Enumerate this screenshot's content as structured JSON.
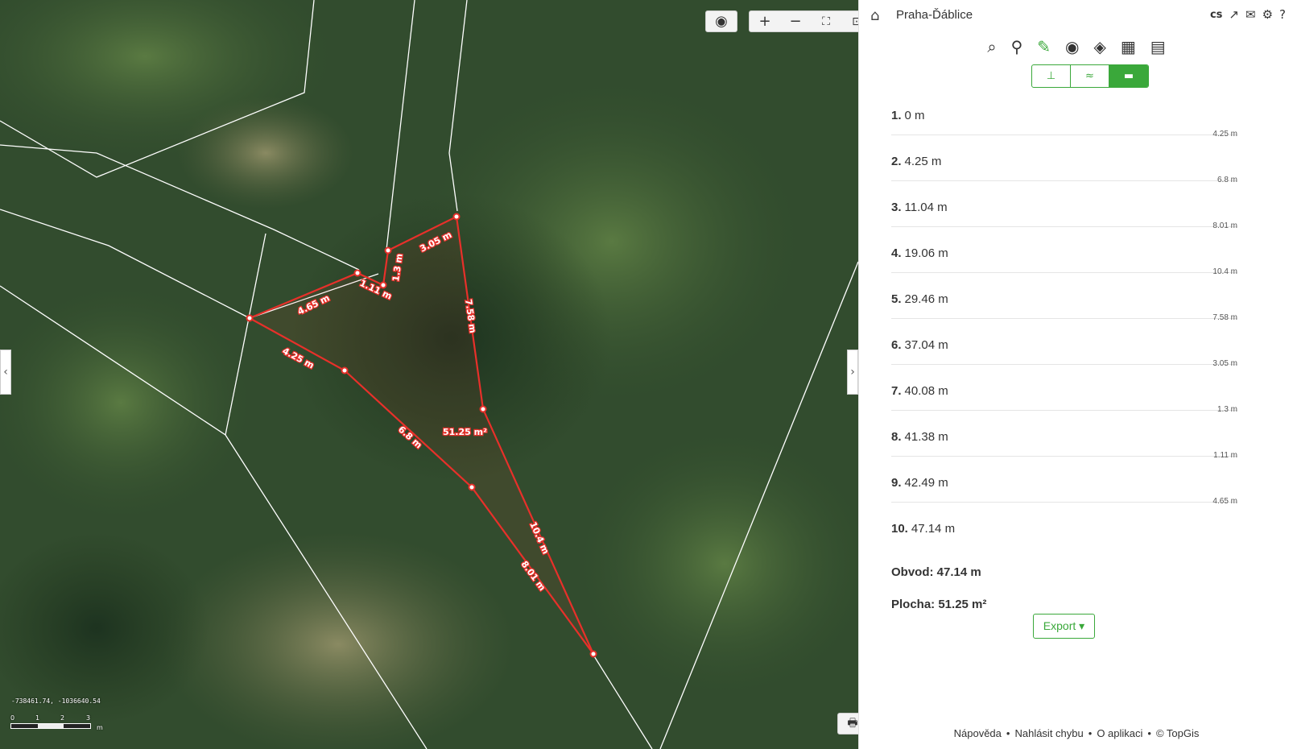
{
  "map": {
    "coordinates": "-738461.74, -1036640.54",
    "scale": {
      "labels": [
        "0",
        "1",
        "2",
        "3"
      ],
      "unit": "m"
    },
    "area_label": "51.25 m²",
    "segment_labels": [
      "4.25 m",
      "6.8 m",
      "8.01 m",
      "10.4 m",
      "7.58 m",
      "3.05 m",
      "1.3 m",
      "1.11 m",
      "4.65 m"
    ],
    "icons": {
      "locate": "locate-icon",
      "zoom_in": "zoom-in-icon",
      "zoom_out": "zoom-out-icon",
      "fullscreen": "fullscreen-icon",
      "extent": "zoom-extent-icon",
      "print": "print-icon"
    },
    "measure_color": "#e8302a"
  },
  "panel": {
    "place": "Praha-Ďáblice",
    "lang": "cs",
    "points": [
      {
        "num": "1.",
        "dist": "0 m",
        "seg": "4.25 m"
      },
      {
        "num": "2.",
        "dist": "4.25 m",
        "seg": "6.8 m"
      },
      {
        "num": "3.",
        "dist": "11.04 m",
        "seg": "8.01 m"
      },
      {
        "num": "4.",
        "dist": "19.06 m",
        "seg": "10.4 m"
      },
      {
        "num": "5.",
        "dist": "29.46 m",
        "seg": "7.58 m"
      },
      {
        "num": "6.",
        "dist": "37.04 m",
        "seg": "3.05 m"
      },
      {
        "num": "7.",
        "dist": "40.08 m",
        "seg": "1.3 m"
      },
      {
        "num": "8.",
        "dist": "41.38 m",
        "seg": "1.11 m"
      },
      {
        "num": "9.",
        "dist": "42.49 m",
        "seg": "4.65 m"
      },
      {
        "num": "10.",
        "dist": "47.14 m",
        "seg": ""
      }
    ],
    "perimeter": "Obvod: 47.14 m",
    "area": "Plocha: 51.25 m²",
    "export_label": "Export ▾",
    "footer": [
      "Nápověda",
      "•",
      "Nahlásit chybu",
      "•",
      "O aplikaci",
      "•",
      "© TopGis"
    ],
    "accent": "#3aa83a"
  }
}
